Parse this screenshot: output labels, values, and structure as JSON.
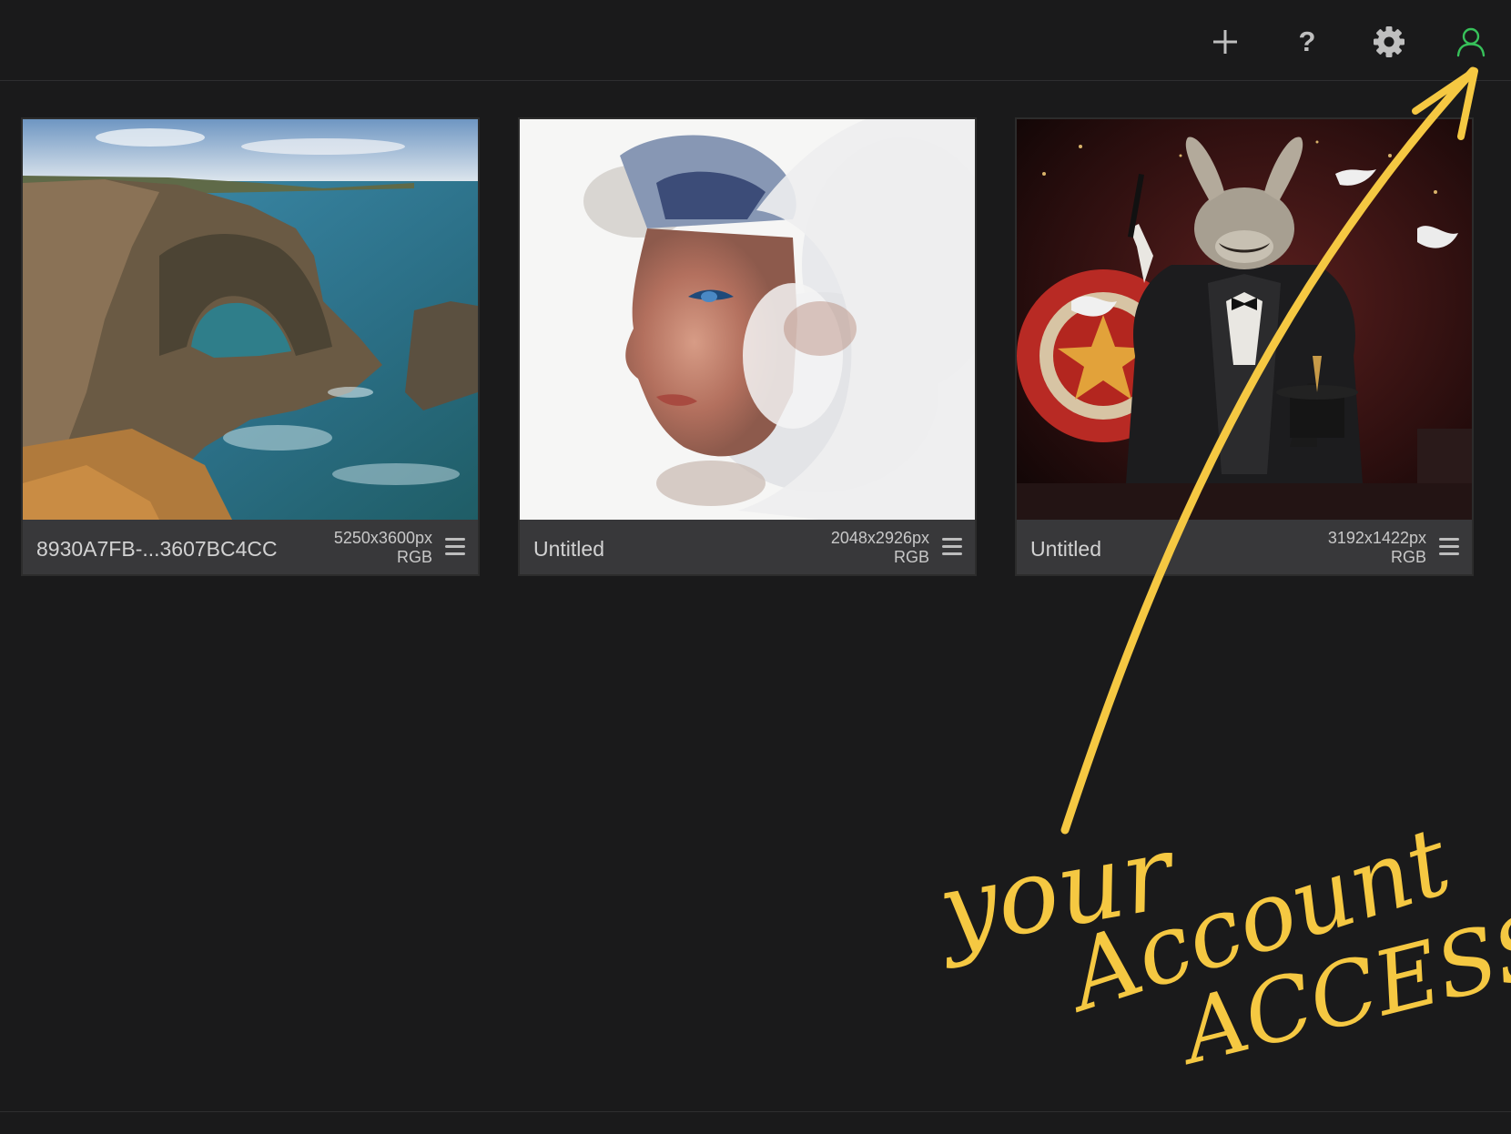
{
  "toolbar": {
    "buttons": [
      {
        "id": "add",
        "icon": "plus-icon"
      },
      {
        "id": "help",
        "icon": "help-question-icon",
        "glyph": "?"
      },
      {
        "id": "settings",
        "icon": "gear-icon"
      },
      {
        "id": "account",
        "icon": "user-icon"
      }
    ]
  },
  "colors": {
    "background": "#1a1a1b",
    "info_bar": "#38383a",
    "icon_gray": "#bfbfbf",
    "account_green": "#37c15a",
    "annotation_yellow": "#f5c842"
  },
  "gallery": {
    "items": [
      {
        "title": "8930A7FB-...3607BC4CC",
        "size": "5250x3600px",
        "mode": "RGB",
        "image": "sea cliffs with natural rock arch"
      },
      {
        "title": "Untitled",
        "size": "2048x2926px",
        "mode": "RGB",
        "image": "woman face dissolving into clouds"
      },
      {
        "title": "Untitled",
        "size": "3192x1422px",
        "mode": "RGB",
        "image": "rabbit magician in tuxedo with doves"
      }
    ]
  },
  "annotation": {
    "lines": [
      "your",
      "Account",
      "ACCESS"
    ]
  }
}
